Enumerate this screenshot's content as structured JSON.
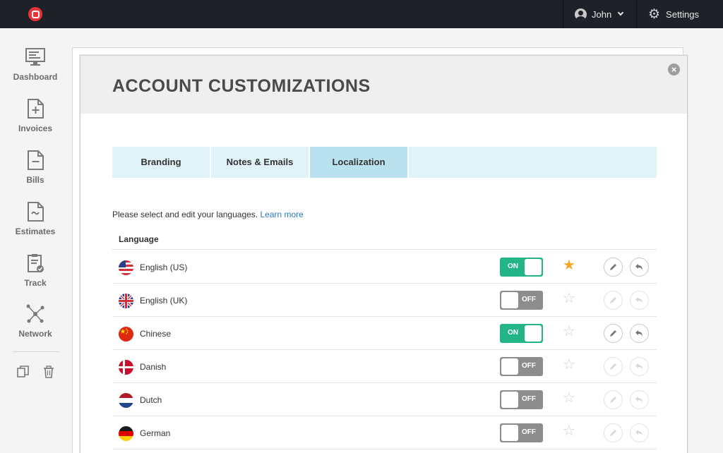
{
  "topbar": {
    "user_name": "John",
    "settings_label": "Settings"
  },
  "sidebar": {
    "items": [
      {
        "label": "Dashboard",
        "icon": "monitor-icon"
      },
      {
        "label": "Invoices",
        "icon": "invoice-add-icon"
      },
      {
        "label": "Bills",
        "icon": "bill-icon"
      },
      {
        "label": "Estimates",
        "icon": "estimate-icon"
      },
      {
        "label": "Track",
        "icon": "clipboard-check-icon"
      },
      {
        "label": "Network",
        "icon": "network-icon"
      }
    ],
    "tools": [
      {
        "icon": "copy-icon"
      },
      {
        "icon": "trash-icon"
      }
    ]
  },
  "modal": {
    "title": "ACCOUNT CUSTOMIZATIONS",
    "close_icon": "close-icon",
    "tabs": [
      {
        "label": "Branding",
        "active": false
      },
      {
        "label": "Notes & Emails",
        "active": false
      },
      {
        "label": "Localization",
        "active": true
      }
    ],
    "intro_text": "Please select and edit your languages.",
    "learn_more": "Learn more",
    "column_header": "Language",
    "languages": [
      {
        "name": "English (US)",
        "flag": "us-flag-icon",
        "enabled": true,
        "toggle_label": "ON",
        "default": true
      },
      {
        "name": "English (UK)",
        "flag": "uk-flag-icon",
        "enabled": false,
        "toggle_label": "OFF",
        "default": false
      },
      {
        "name": "Chinese",
        "flag": "china-flag-icon",
        "enabled": true,
        "toggle_label": "ON",
        "default": false
      },
      {
        "name": "Danish",
        "flag": "denmark-flag-icon",
        "enabled": false,
        "toggle_label": "OFF",
        "default": false
      },
      {
        "name": "Dutch",
        "flag": "netherlands-flag-icon",
        "enabled": false,
        "toggle_label": "OFF",
        "default": false
      },
      {
        "name": "German",
        "flag": "germany-flag-icon",
        "enabled": false,
        "toggle_label": "OFF",
        "default": false
      }
    ]
  },
  "colors": {
    "topbar_bg": "#1e2228",
    "brand_red": "#e8333a",
    "toggle_on": "#23b487",
    "toggle_off": "#8d8d8d",
    "star_active": "#f5a623",
    "tab_bg": "#dff3f8",
    "tab_active_bg": "#b9e2ee",
    "link": "#2a78c8"
  }
}
